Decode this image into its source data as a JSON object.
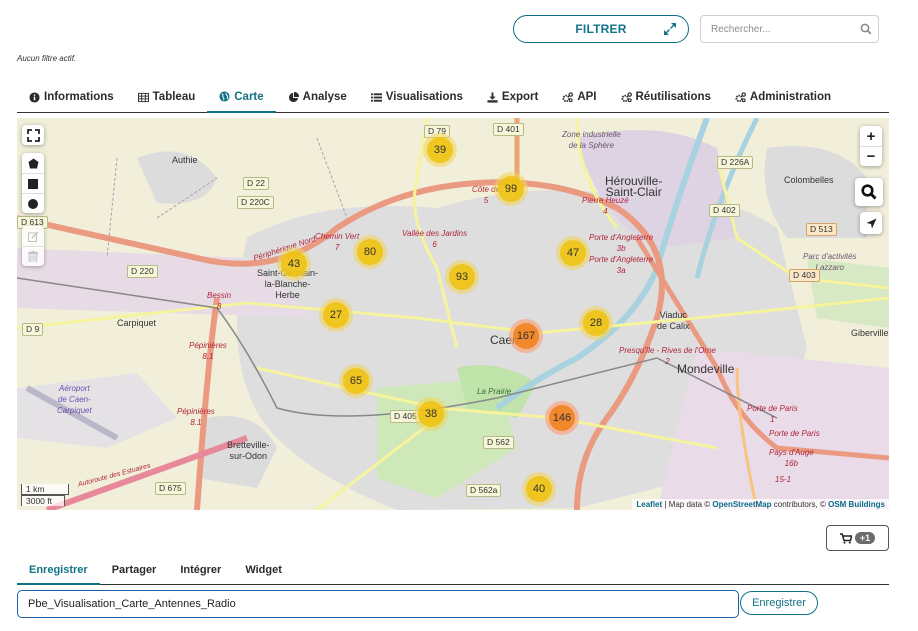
{
  "header": {
    "filter_button": "FILTRER",
    "search_placeholder": "Rechercher...",
    "filter_status": "Aucun filtre actif."
  },
  "tabs": [
    {
      "label": "Informations",
      "icon": "info-circle-icon",
      "active": false
    },
    {
      "label": "Tableau",
      "icon": "table-icon",
      "active": false
    },
    {
      "label": "Carte",
      "icon": "globe-icon",
      "active": true
    },
    {
      "label": "Analyse",
      "icon": "pie-chart-icon",
      "active": false
    },
    {
      "label": "Visualisations",
      "icon": "list-icon",
      "active": false
    },
    {
      "label": "Export",
      "icon": "download-icon",
      "active": false
    },
    {
      "label": "API",
      "icon": "cogs-icon",
      "active": false
    },
    {
      "label": "Réutilisations",
      "icon": "cogs-icon",
      "active": false
    },
    {
      "label": "Administration",
      "icon": "cogs-icon",
      "active": false
    }
  ],
  "map": {
    "clusters": [
      {
        "count": "39",
        "size": "medium"
      },
      {
        "count": "99",
        "size": "medium"
      },
      {
        "count": "80",
        "size": "medium"
      },
      {
        "count": "43",
        "size": "medium"
      },
      {
        "count": "47",
        "size": "medium"
      },
      {
        "count": "93",
        "size": "medium"
      },
      {
        "count": "27",
        "size": "medium"
      },
      {
        "count": "28",
        "size": "medium"
      },
      {
        "count": "167",
        "size": "large"
      },
      {
        "count": "65",
        "size": "medium"
      },
      {
        "count": "38",
        "size": "medium"
      },
      {
        "count": "146",
        "size": "large"
      },
      {
        "count": "40",
        "size": "medium"
      }
    ],
    "road_labels": [
      "D 79",
      "D 401",
      "D 22",
      "D 220C",
      "D 613",
      "D 220",
      "D 9",
      "D 226A",
      "D 402",
      "D 513",
      "D 403",
      "D 405",
      "D 562",
      "D 562a",
      "D 675"
    ],
    "places": {
      "authie": "Authie",
      "saint_germain": "Saint-Germain-\nla-Blanche-\nHerbe",
      "carpiquet": "Carpiquet",
      "aeroport": "Aéroport\nde Caen-\nCarpiquet",
      "bretteville": "Bretteville-\nsur-Odon",
      "caen": "Caen",
      "herouville": "Hérouville-\nSaint-Clair",
      "colombelles": "Colombelles",
      "zone_sphere": "Zone industrielle\nde la Sphère",
      "parc_lazzaro": "Parc d'activités\nLazzaro",
      "viaduc": "Viaduc\nde Calix",
      "mondeville": "Mondeville",
      "giberville": "Giberville",
      "la_prairie": "La Prairie"
    },
    "exits": {
      "cote_de_nacre": "Côte de\n5",
      "pierre_heuze": "Pierre Heuzé\n4",
      "porte_angleterre_3b": "Porte d'Angleterre\n3b",
      "porte_angleterre_3a": "Porte d'Angleterre\n3a",
      "chemin_vert": "Chemin Vert\n7",
      "vallee_jardins": "Vallée des Jardins\n6",
      "peripherique_nord": "Périphérique Nord",
      "bessin": "Bessin\n8",
      "pepinieres_1": "Pépinières\n8.1",
      "pepinieres_2": "Pépinières\n8.1",
      "presquile": "Presqu'île - Rives de l'Orne\n2",
      "porte_paris_1": "Porte de Paris\n1",
      "porte_paris_2": "Porte de Paris",
      "pays_auge": "Pays d'Auge\n16b",
      "exit_15": "15-1",
      "autoroute": "Autoroute des Estuaires"
    },
    "controls": {
      "zoom_in": "+",
      "zoom_out": "−"
    },
    "scale": {
      "metric": "1 km",
      "imperial": "3000 ft"
    },
    "attribution": {
      "leaflet": "Leaflet",
      "sep": " | Map data © ",
      "osm": "OpenStreetMap",
      "contrib": " contributors, © ",
      "osmb": "OSM Buildings"
    }
  },
  "cart": {
    "badge": "+1"
  },
  "bottom_tabs": [
    {
      "label": "Enregistrer",
      "active": true
    },
    {
      "label": "Partager",
      "active": false
    },
    {
      "label": "Intégrer",
      "active": false
    },
    {
      "label": "Widget",
      "active": false
    }
  ],
  "save": {
    "name_value": "Pbe_Visualisation_Carte_Antennes_Radio",
    "button_label": "Enregistrer"
  },
  "colors": {
    "accent": "#127385",
    "cluster_medium": "#f0c20c",
    "cluster_large": "#f18017"
  }
}
